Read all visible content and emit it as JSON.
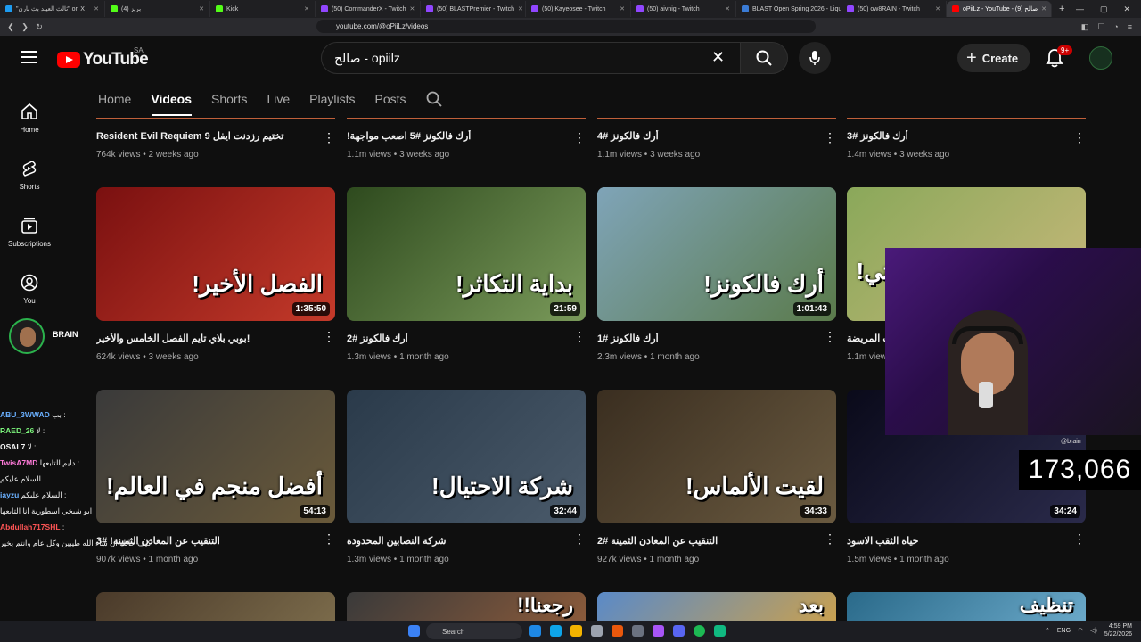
{
  "browser": {
    "tabs": [
      {
        "title": "\"ثالث العيـد بث بارن\" on X",
        "favcolor": "#1d9bf0",
        "active": false
      },
      {
        "title": "(4) بريز",
        "favcolor": "#53fc18",
        "active": false
      },
      {
        "title": "Kick",
        "favcolor": "#53fc18",
        "active": false
      },
      {
        "title": "(50) CommanderX - Twitch",
        "favcolor": "#9146ff",
        "active": false
      },
      {
        "title": "(50) BLASTPremier - Twitch",
        "favcolor": "#9146ff",
        "active": false
      },
      {
        "title": "(50) Kayeosee - Twitch",
        "favcolor": "#9146ff",
        "active": false
      },
      {
        "title": "(50) aivnig - Twitch",
        "favcolor": "#9146ff",
        "active": false
      },
      {
        "title": "BLAST Open Spring 2026 - Liquipedia",
        "favcolor": "#3a7bd5",
        "active": false
      },
      {
        "title": "(50) ow8RAIN - Twitch",
        "favcolor": "#9146ff",
        "active": false
      },
      {
        "title": "oPiiLz - YouTube - صالح (9)",
        "favcolor": "#ff0000",
        "active": true
      }
    ],
    "new_tab": "+",
    "url": "youtube.com/@oPiiLz/videos"
  },
  "header": {
    "logo_text": "YouTube",
    "country_code": "SA",
    "search_value": "صالح - opiilz",
    "create_label": "Create",
    "notif_count": "9+"
  },
  "sidebar": {
    "items": [
      {
        "label": "Home",
        "icon": "home-icon"
      },
      {
        "label": "Shorts",
        "icon": "shorts-icon"
      },
      {
        "label": "Subscriptions",
        "icon": "subscriptions-icon"
      },
      {
        "label": "You",
        "icon": "you-icon"
      }
    ],
    "channel_label": "BRAIN"
  },
  "channel_tabs": [
    "Home",
    "Videos",
    "Shorts",
    "Live",
    "Playlists",
    "Posts"
  ],
  "videos_row0": [
    {
      "title": "Resident Evil Requiem تختيم رزدنت ايفل 9",
      "views": "764k views",
      "age": "2 weeks ago"
    },
    {
      "title": "!أرك فالكونز #5 اصعب مواجهة",
      "views": "1.1m views",
      "age": "3 weeks ago"
    },
    {
      "title": "أرك فالكونز #4",
      "views": "1.1m views",
      "age": "3 weeks ago"
    },
    {
      "title": "أرك فالكونز #3",
      "views": "1.4m views",
      "age": "3 weeks ago"
    }
  ],
  "videos_row1": [
    {
      "title": "بوبي بلاي تايم الفصل الخامس والأخير!",
      "views": "624k views",
      "age": "3 weeks ago",
      "duration": "1:35:50",
      "overlay": "الفصل الأخير!",
      "bg": [
        "#7a1010",
        "#c43a2a"
      ]
    },
    {
      "title": "أرك فالكونز #2",
      "views": "1.3m views",
      "age": "1 month ago",
      "duration": "21:59",
      "overlay": "بداية التكاثر!",
      "bg": [
        "#2e4a1e",
        "#7a9a5a"
      ]
    },
    {
      "title": "أرك فالكونز #1",
      "views": "2.3m views",
      "age": "1 month ago",
      "duration": "1:01:43",
      "overlay": "أرك فالكونز!",
      "bg": [
        "#7fa4b8",
        "#5a7a4a"
      ]
    },
    {
      "title": "ت المريضة",
      "views": "1.1m views",
      "age": "",
      "duration": "",
      "overlay": "حديقة حيوانات بصوتي!",
      "bg": [
        "#8aa85a",
        "#c8b87a"
      ]
    }
  ],
  "videos_row2": [
    {
      "title": "التنقيب عن المعادن الثمينة! #3",
      "views": "907k views",
      "age": "1 month ago",
      "duration": "54:13",
      "overlay": "أفضل منجم في العالم!",
      "bg": [
        "#3a3a3a",
        "#6a5a3a"
      ]
    },
    {
      "title": "شركة النصابين المحدودة",
      "views": "1.3m views",
      "age": "1 month ago",
      "duration": "32:44",
      "overlay": "شركة الاحتيال!",
      "bg": [
        "#2a3a4a",
        "#4a5a6a"
      ]
    },
    {
      "title": "التنقيب عن المعادن الثمينة #2",
      "views": "927k views",
      "age": "1 month ago",
      "duration": "34:33",
      "overlay": "لقيت الألماس!",
      "bg": [
        "#3a2e20",
        "#6a5a40"
      ]
    },
    {
      "title": "حياة الثقب الاسود",
      "views": "1.5m views",
      "age": "1 month ago",
      "duration": "34:24",
      "overlay": "",
      "bg": [
        "#0a0a1a",
        "#2a2a4a"
      ]
    }
  ],
  "videos_row3": [
    {
      "overlay": "",
      "bg": [
        "#4a3a2a",
        "#7a6a4a"
      ]
    },
    {
      "overlay": "رجعنا!!",
      "bg": [
        "#3a3a3a",
        "#8a5a3a"
      ]
    },
    {
      "overlay": "بعد",
      "bg": [
        "#5a8ac8",
        "#c8a050"
      ]
    },
    {
      "overlay": "تنظيف",
      "bg": [
        "#2a6a8a",
        "#6aa8c8"
      ]
    }
  ],
  "stream": {
    "cam_label": "@brain",
    "counter": "173,066"
  },
  "chat": [
    {
      "name": "ABU_3WWAD",
      "msg": "بب :",
      "color": "#6ab0ff"
    },
    {
      "name": "RAED_26",
      "msg": "لا :",
      "color": "#7cf57c"
    },
    {
      "name": "OSAL7",
      "msg": "لا :",
      "color": "#f5f5f5"
    },
    {
      "name": "TwisA7MD",
      "msg": "دايم التابعها :",
      "color": "#ff7ad9"
    },
    {
      "name": "",
      "msg": "السلام عليكم",
      "color": "#ffffff"
    },
    {
      "name": "iayzu",
      "msg": "السلام عليكم :",
      "color": "#6ab0ff"
    },
    {
      "name": "",
      "msg": "ابو شيخي اسطورية انا التابعها",
      "color": "#ffffff"
    },
    {
      "name": "Abdullah717SHL",
      "msg": ":",
      "color": "#ff5555"
    },
    {
      "name": "",
      "msg": "كيف حالك ان شاء الله طيبين وكل عام وانتم بخير",
      "color": "#ffffff"
    }
  ],
  "taskbar": {
    "search_placeholder": "Search",
    "lang": "ENG",
    "time": "4:59 PM",
    "date": "5/22/2026"
  }
}
